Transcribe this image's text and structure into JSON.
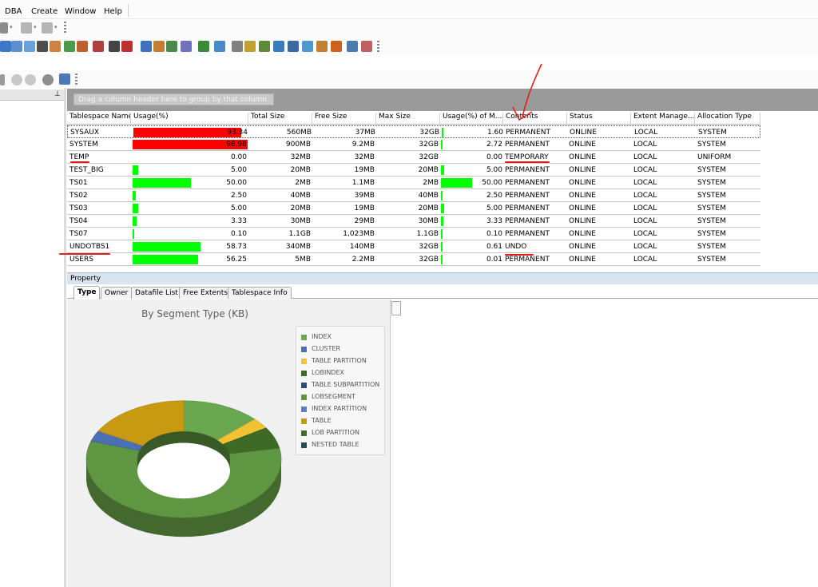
{
  "menu": [
    "DBA",
    "Create",
    "Window",
    "Help"
  ],
  "group_panel": {
    "hint": "Drag a column header here to group by that column."
  },
  "columns": [
    "Tablespace Name",
    "Usage(%)",
    "Total Size",
    "Free Size",
    "Max Size",
    "Usage(%) of M...",
    "Contents",
    "Status",
    "Extent Manage...",
    "Allocation Type"
  ],
  "rows": [
    {
      "name": "SYSAUX",
      "usage": "93.34",
      "usage_pct": 93.34,
      "usage_color": "#ff0000",
      "total": "560MB",
      "free": "37MB",
      "max": "32GB",
      "maxpct": "1.60",
      "maxpct_val": 1.6,
      "contents": "PERMANENT",
      "status": "ONLINE",
      "extent": "LOCAL",
      "alloc": "SYSTEM"
    },
    {
      "name": "SYSTEM",
      "usage": "98.98",
      "usage_pct": 98.98,
      "usage_color": "#ff0000",
      "total": "900MB",
      "free": "9.2MB",
      "max": "32GB",
      "maxpct": "2.72",
      "maxpct_val": 2.72,
      "contents": "PERMANENT",
      "status": "ONLINE",
      "extent": "LOCAL",
      "alloc": "SYSTEM"
    },
    {
      "name": "TEMP",
      "usage": "0.00",
      "usage_pct": 0,
      "usage_color": "#00ff00",
      "total": "32MB",
      "free": "32MB",
      "max": "32GB",
      "maxpct": "0.00",
      "maxpct_val": 0,
      "contents": "TEMPORARY",
      "status": "ONLINE",
      "extent": "LOCAL",
      "alloc": "UNIFORM"
    },
    {
      "name": "TEST_BIG",
      "usage": "5.00",
      "usage_pct": 5.0,
      "usage_color": "#00ff00",
      "total": "20MB",
      "free": "19MB",
      "max": "20MB",
      "maxpct": "5.00",
      "maxpct_val": 5.0,
      "contents": "PERMANENT",
      "status": "ONLINE",
      "extent": "LOCAL",
      "alloc": "SYSTEM"
    },
    {
      "name": "TS01",
      "usage": "50.00",
      "usage_pct": 50.0,
      "usage_color": "#00ff00",
      "total": "2MB",
      "free": "1.1MB",
      "max": "2MB",
      "maxpct": "50.00",
      "maxpct_val": 50.0,
      "contents": "PERMANENT",
      "status": "ONLINE",
      "extent": "LOCAL",
      "alloc": "SYSTEM"
    },
    {
      "name": "TS02",
      "usage": "2.50",
      "usage_pct": 2.5,
      "usage_color": "#00ff00",
      "total": "40MB",
      "free": "39MB",
      "max": "40MB",
      "maxpct": "2.50",
      "maxpct_val": 2.5,
      "contents": "PERMANENT",
      "status": "ONLINE",
      "extent": "LOCAL",
      "alloc": "SYSTEM"
    },
    {
      "name": "TS03",
      "usage": "5.00",
      "usage_pct": 5.0,
      "usage_color": "#00ff00",
      "total": "20MB",
      "free": "19MB",
      "max": "20MB",
      "maxpct": "5.00",
      "maxpct_val": 5.0,
      "contents": "PERMANENT",
      "status": "ONLINE",
      "extent": "LOCAL",
      "alloc": "SYSTEM"
    },
    {
      "name": "TS04",
      "usage": "3.33",
      "usage_pct": 3.33,
      "usage_color": "#00ff00",
      "total": "30MB",
      "free": "29MB",
      "max": "30MB",
      "maxpct": "3.33",
      "maxpct_val": 3.33,
      "contents": "PERMANENT",
      "status": "ONLINE",
      "extent": "LOCAL",
      "alloc": "SYSTEM"
    },
    {
      "name": "TS07",
      "usage": "0.10",
      "usage_pct": 0.1,
      "usage_color": "#00ff00",
      "total": "1.1GB",
      "free": "1,023MB",
      "max": "1.1GB",
      "maxpct": "0.10",
      "maxpct_val": 0.1,
      "contents": "PERMANENT",
      "status": "ONLINE",
      "extent": "LOCAL",
      "alloc": "SYSTEM"
    },
    {
      "name": "UNDOTBS1",
      "usage": "58.73",
      "usage_pct": 58.73,
      "usage_color": "#00ff00",
      "total": "340MB",
      "free": "140MB",
      "max": "32GB",
      "maxpct": "0.61",
      "maxpct_val": 0.61,
      "contents": "UNDO",
      "status": "ONLINE",
      "extent": "LOCAL",
      "alloc": "SYSTEM"
    },
    {
      "name": "USERS",
      "usage": "56.25",
      "usage_pct": 56.25,
      "usage_color": "#00ff00",
      "total": "5MB",
      "free": "2.2MB",
      "max": "32GB",
      "maxpct": "0.01",
      "maxpct_val": 0.01,
      "contents": "PERMANENT",
      "status": "ONLINE",
      "extent": "LOCAL",
      "alloc": "SYSTEM"
    }
  ],
  "property": {
    "title": "Property",
    "tabs": [
      "Type",
      "Owner",
      "Datafile List",
      "Free Extents",
      "Tablespace Info"
    ],
    "active_tab": "Type"
  },
  "chart_data": {
    "type": "pie",
    "style": "3d-donut",
    "title": "By Segment Type (KB)",
    "legend_position": "right",
    "legend": [
      {
        "name": "INDEX",
        "color": "#6aa84f"
      },
      {
        "name": "CLUSTER",
        "color": "#4a6fb5"
      },
      {
        "name": "TABLE PARTITION",
        "color": "#f1c232"
      },
      {
        "name": "LOBINDEX",
        "color": "#3d6b25"
      },
      {
        "name": "TABLE SUBPARTITION",
        "color": "#2f4b7c"
      },
      {
        "name": "LOBSEGMENT",
        "color": "#5f9641"
      },
      {
        "name": "INDEX PARTITION",
        "color": "#5b7fc0"
      },
      {
        "name": "TABLE",
        "color": "#c79a12"
      },
      {
        "name": "LOB PARTITION",
        "color": "#436b2b"
      },
      {
        "name": "NESTED TABLE",
        "color": "#2b4a57"
      }
    ],
    "slices": [
      {
        "name": "INDEX",
        "value": 13
      },
      {
        "name": "TABLE PARTITION",
        "value": 3
      },
      {
        "name": "LOBINDEX",
        "value": 6
      },
      {
        "name": "LOBSEGMENT",
        "value": 58
      },
      {
        "name": "CLUSTER",
        "value": 3
      },
      {
        "name": "TABLE",
        "value": 17
      }
    ]
  }
}
